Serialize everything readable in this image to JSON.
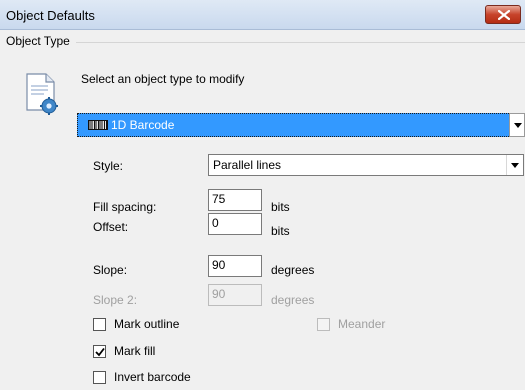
{
  "window": {
    "title": "Object Defaults"
  },
  "object_type": {
    "group_label": "Object Type",
    "prompt": "Select an object type to modify",
    "selected": "1D Barcode"
  },
  "style": {
    "label": "Style:",
    "value": "Parallel lines"
  },
  "fill_spacing": {
    "label": "Fill spacing:",
    "value": "75",
    "unit": "bits"
  },
  "offset": {
    "label": "Offset:",
    "value": "0",
    "unit": "bits"
  },
  "slope": {
    "label": "Slope:",
    "value": "90",
    "unit": "degrees"
  },
  "slope2": {
    "label": "Slope 2:",
    "value": "90",
    "unit": "degrees",
    "enabled": false
  },
  "checkboxes": {
    "mark_outline": {
      "label": "Mark outline",
      "checked": false
    },
    "meander": {
      "label": "Meander",
      "checked": false,
      "enabled": false
    },
    "mark_fill": {
      "label": "Mark fill",
      "checked": true
    },
    "invert_barcode": {
      "label": "Invert barcode",
      "checked": false
    }
  },
  "icons": {
    "close": "close-icon",
    "document": "document-settings-icon",
    "barcode": "barcode-icon",
    "dropdown": "chevron-down-icon",
    "check": "checkmark-icon"
  },
  "colors": {
    "selection": "#3399ff",
    "close_button": "#c7432b",
    "disabled_text": "#a0a0a0"
  }
}
